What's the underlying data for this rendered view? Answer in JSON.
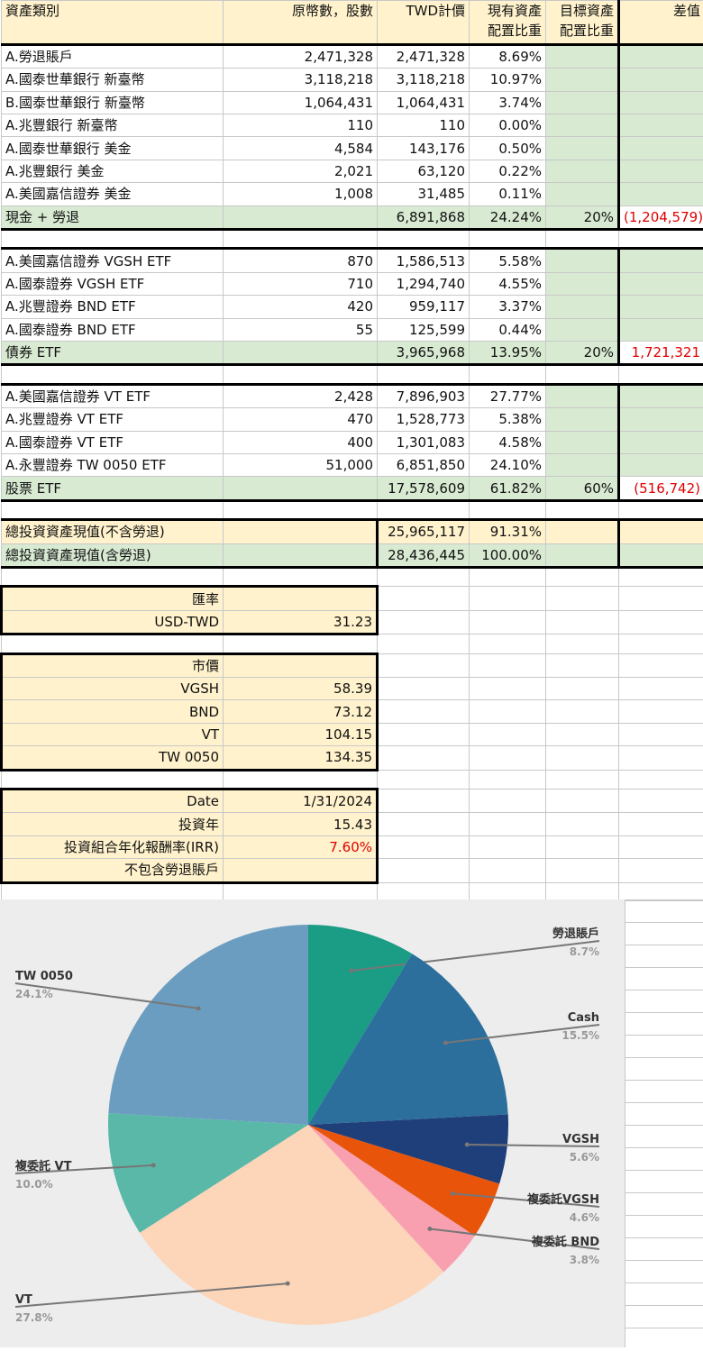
{
  "columns": [
    "資產類別",
    "原幣數，股數",
    "TWD計價",
    "現有資產配置比重",
    "目標資產配置比重",
    "差值"
  ],
  "header": {
    "col_a": "資產類別",
    "col_b": "原幣數，股數",
    "col_c": "TWD計價",
    "col_d1": "現有資產",
    "col_d2": "配置比重",
    "col_e1": "目標資產",
    "col_e2": "配置比重",
    "col_f": "差值"
  },
  "cash_rows": [
    {
      "name": "A.勞退賬戶",
      "qty": "2,471,328",
      "twd": "2,471,328",
      "pct": "8.69%"
    },
    {
      "name": "A.國泰世華銀行 新臺幣",
      "qty": "3,118,218",
      "twd": "3,118,218",
      "pct": "10.97%"
    },
    {
      "name": "B.國泰世華銀行 新臺幣",
      "qty": "1,064,431",
      "twd": "1,064,431",
      "pct": "3.74%"
    },
    {
      "name": "A.兆豐銀行 新臺幣",
      "qty": "110",
      "twd": "110",
      "pct": "0.00%"
    },
    {
      "name": "A.國泰世華銀行 美金",
      "qty": "4,584",
      "twd": "143,176",
      "pct": "0.50%"
    },
    {
      "name": "A.兆豐銀行 美金",
      "qty": "2,021",
      "twd": "63,120",
      "pct": "0.22%"
    },
    {
      "name": "A.美國嘉信證券 美金",
      "qty": "1,008",
      "twd": "31,485",
      "pct": "0.11%"
    }
  ],
  "cash_total": {
    "name": "現金 + 勞退",
    "twd": "6,891,868",
    "pct": "24.24%",
    "target": "20%",
    "diff": "(1,204,579)"
  },
  "bond_rows": [
    {
      "name": "A.美國嘉信證券 VGSH ETF",
      "qty": "870",
      "twd": "1,586,513",
      "pct": "5.58%"
    },
    {
      "name": "A.國泰證券 VGSH ETF",
      "qty": "710",
      "twd": "1,294,740",
      "pct": "4.55%"
    },
    {
      "name": "A.兆豐證券 BND ETF",
      "qty": "420",
      "twd": "959,117",
      "pct": "3.37%"
    },
    {
      "name": "A.國泰證券 BND ETF",
      "qty": "55",
      "twd": "125,599",
      "pct": "0.44%"
    }
  ],
  "bond_total": {
    "name": "債券 ETF",
    "twd": "3,965,968",
    "pct": "13.95%",
    "target": "20%",
    "diff": "1,721,321"
  },
  "stock_rows": [
    {
      "name": "A.美國嘉信證券 VT ETF",
      "qty": "2,428",
      "twd": "7,896,903",
      "pct": "27.77%"
    },
    {
      "name": "A.兆豐證券 VT ETF",
      "qty": "470",
      "twd": "1,528,773",
      "pct": "5.38%"
    },
    {
      "name": "A.國泰證券 VT ETF",
      "qty": "400",
      "twd": "1,301,083",
      "pct": "4.58%"
    },
    {
      "name": "A.永豐證券 TW 0050 ETF",
      "qty": "51,000",
      "twd": "6,851,850",
      "pct": "24.10%"
    }
  ],
  "stock_total": {
    "name": "股票 ETF",
    "twd": "17,578,609",
    "pct": "61.82%",
    "target": "60%",
    "diff": "(516,742)"
  },
  "totals": [
    {
      "name": "總投資資產現值(不含勞退)",
      "twd": "25,965,117",
      "pct": "91.31%"
    },
    {
      "name": "總投資資產現值(含勞退)",
      "twd": "28,436,445",
      "pct": "100.00%"
    }
  ],
  "fx": {
    "title": "匯率",
    "label": "USD-TWD",
    "value": "31.23"
  },
  "prices": {
    "title": "市價",
    "items": [
      {
        "label": "VGSH",
        "value": "58.39"
      },
      {
        "label": "BND",
        "value": "73.12"
      },
      {
        "label": "VT",
        "value": "104.15"
      },
      {
        "label": "TW 0050",
        "value": "134.35"
      }
    ]
  },
  "info": {
    "date_label": "Date",
    "date_value": "1/31/2024",
    "years_label": "投資年",
    "years_value": "15.43",
    "irr_label": "投資組合年化報酬率(IRR)",
    "irr_value": "7.60%",
    "irr_note": "不包含勞退賬戶"
  },
  "colors": {
    "header_bg": "#fff2cc",
    "subtotal_bg": "#d9ead3",
    "negative": "#e00000"
  },
  "chart_data": {
    "type": "pie",
    "slices": [
      {
        "label": "勞退賬戶",
        "value": 8.7,
        "pct_label": "8.7%",
        "color": "#1b9c85"
      },
      {
        "label": "Cash",
        "value": 15.5,
        "pct_label": "15.5%",
        "color": "#2c6f9c"
      },
      {
        "label": "VGSH",
        "value": 5.6,
        "pct_label": "5.6%",
        "color": "#1f3f7a"
      },
      {
        "label": "複委託VGSH",
        "value": 4.6,
        "pct_label": "4.6%",
        "color": "#e8540a"
      },
      {
        "label": "複委託 BND",
        "value": 3.8,
        "pct_label": "3.8%",
        "color": "#f9a0b0"
      },
      {
        "label": "VT",
        "value": 27.8,
        "pct_label": "27.8%",
        "color": "#fdd5b8"
      },
      {
        "label": "複委託 VT",
        "value": 10.0,
        "pct_label": "10.0%",
        "color": "#5ab8a8"
      },
      {
        "label": "TW 0050",
        "value": 24.1,
        "pct_label": "24.1%",
        "color": "#6b9dc0"
      }
    ]
  }
}
